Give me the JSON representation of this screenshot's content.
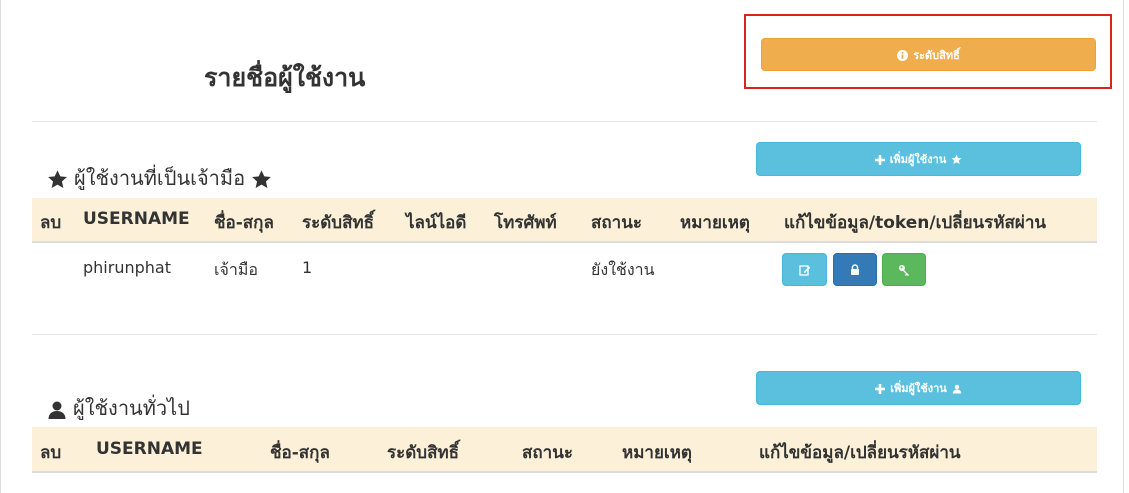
{
  "page_title": "รายชื่อผู้ใช้งาน",
  "permission_button": {
    "label": "ระดับสิทธิ์",
    "icon": "info-circle-icon"
  },
  "owner_section": {
    "title": "ผู้ใช้งานที่เป็นเจ้ามือ",
    "add_button_label": "เพิ่มผู้ใช้งาน",
    "columns": [
      "ลบ",
      "USERNAME",
      "ชื่อ-สกุล",
      "ระดับสิทธิ์",
      "ไลน์ไอดี",
      "โทรศัพท์",
      "สถานะ",
      "หมายเหตุ",
      "แก้ไขข้อมูล/token/เปลี่ยนรหัสผ่าน"
    ],
    "rows": [
      {
        "username": "phirunphat",
        "fullname": "เจ้ามือ",
        "level": "1",
        "line_id": "",
        "phone": "",
        "status": "ยังใช้งาน",
        "note": ""
      }
    ]
  },
  "general_section": {
    "title": "ผู้ใช้งานทั่วไป",
    "add_button_label": "เพิ่มผู้ใช้งาน",
    "columns": [
      "ลบ",
      "USERNAME",
      "ชื่อ-สกุล",
      "ระดับสิทธิ์",
      "สถานะ",
      "หมายเหตุ",
      "แก้ไขข้อมูล/เปลี่ยนรหัสผ่าน"
    ]
  },
  "colors": {
    "warning": "#f0ad4e",
    "info": "#5bc0de",
    "primary": "#337ab7",
    "success": "#5cb85c",
    "table_header": "#fcf1d8",
    "highlight": "#d9231f"
  }
}
